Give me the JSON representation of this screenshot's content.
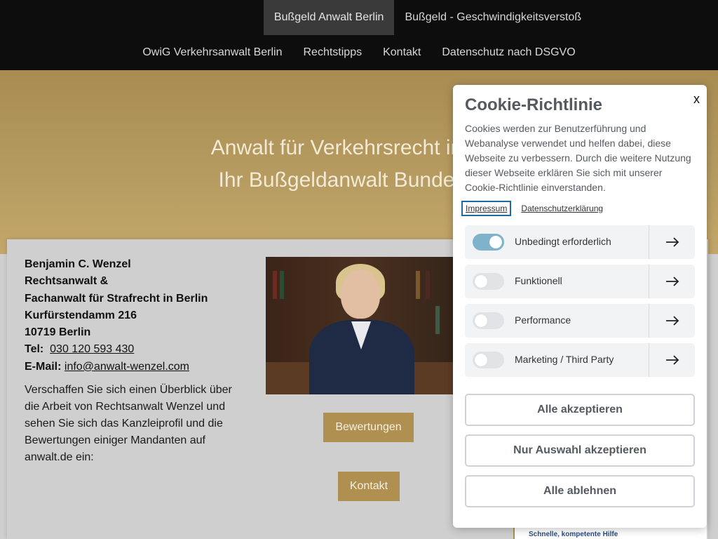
{
  "nav": {
    "row1": [
      {
        "label": "Bußgeld Anwalt Berlin",
        "active": true
      },
      {
        "label": "Bußgeld - Geschwindigkeitsverstoß",
        "active": false
      }
    ],
    "row2": [
      {
        "label": "OwiG Verkehrsanwalt Berlin"
      },
      {
        "label": "Rechtstipps"
      },
      {
        "label": "Kontakt"
      },
      {
        "label": "Datenschutz nach DSGVO"
      }
    ]
  },
  "hero": {
    "line1": "Anwalt für Verkehrsrecht in",
    "line2": "Ihr Bußgeldanwalt Bunde"
  },
  "contact": {
    "name": "Benjamin C. Wenzel",
    "title1": "Rechtsanwalt &",
    "title2": "Fachanwalt für Strafrecht in Berlin",
    "street": "Kurfürstendamm 216",
    "city": "10719 Berlin",
    "tel_label": "Tel:",
    "tel": "030 120 593 430",
    "email_label": "E-Mail:",
    "email": "info@anwalt-wenzel.com"
  },
  "intro": "Verschaffen Sie sich einen Überblick über die Arbeit von Rechtsanwalt Wenzel und sehen Sie sich das Kanzleiprofil und die Bewertungen einiger Mandanten auf anwalt.de ein:",
  "buttons": {
    "reviews": "Bewertungen",
    "contact": "Kontakt"
  },
  "side_note": "Schnelle, kompetente Hilfe",
  "cookie": {
    "close": "x",
    "title": "Cookie-Richtlinie",
    "text": "Cookies werden zur Benutzerführung und Webanalyse verwendet und helfen dabei, diese Webseite zu verbessern. Durch die weitere Nutzung dieser Webseite erklären Sie sich mit unserer Cookie-Richtlinie einverstanden.",
    "links": [
      "Impressum",
      "Datenschutzerklärung"
    ],
    "categories": [
      {
        "label": "Unbedingt erforderlich",
        "enabled": true
      },
      {
        "label": "Funktionell",
        "enabled": false
      },
      {
        "label": "Performance",
        "enabled": false
      },
      {
        "label": "Marketing / Third Party",
        "enabled": false
      }
    ],
    "accept_all": "Alle akzeptieren",
    "accept_selection": "Nur Auswahl akzeptieren",
    "reject_all": "Alle ablehnen"
  },
  "colors": {
    "nav_bg": "#0d0d0d",
    "hero_gold": "#b79c61",
    "button_gold": "#b09050",
    "toggle_on": "#7fb3cc",
    "link_blue": "#2a4d86"
  }
}
